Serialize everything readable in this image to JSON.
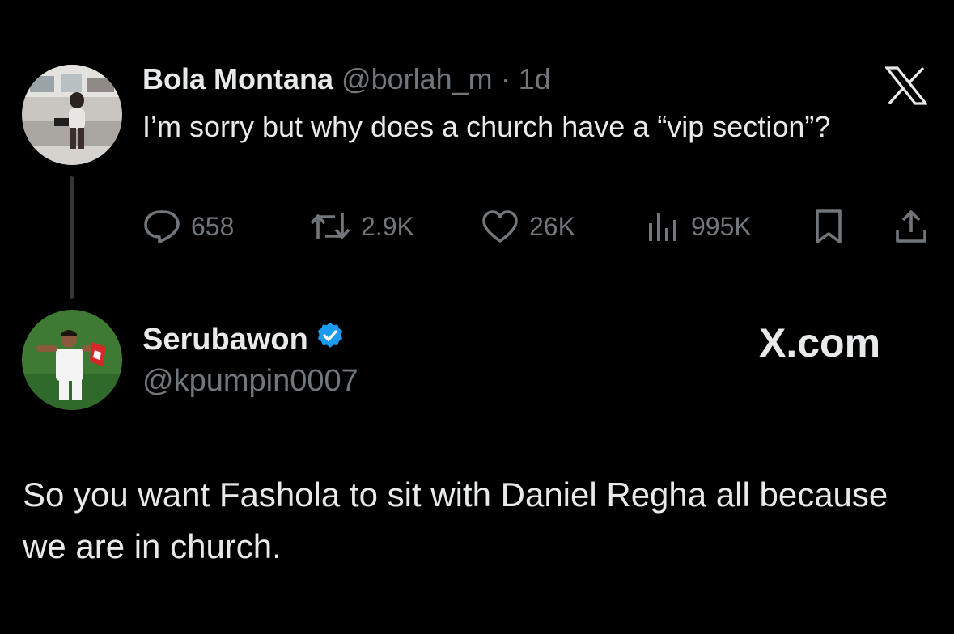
{
  "parent_tweet": {
    "author_name": "Bola Montana",
    "author_handle": "@borlah_m",
    "separator": "·",
    "time": "1d",
    "text": "I’m sorry but why does a church have a “vip section”?",
    "actions": {
      "replies": "658",
      "reposts": "2.9K",
      "likes": "26K",
      "views": "995K"
    },
    "icons": [
      "reply-icon",
      "repost-icon",
      "like-icon",
      "views-icon",
      "bookmark-icon",
      "share-icon",
      "x-logo-icon"
    ]
  },
  "reply_tweet": {
    "author_name": "Serubawon",
    "author_handle": "@kpumpin0007",
    "verified": true,
    "text": "So you want Fashola to sit with Daniel Regha all because we are in church.",
    "watermark": "X.com"
  },
  "colors": {
    "background": "#000000",
    "text_primary": "#e7e9ea",
    "text_secondary": "#71767b",
    "verified_badge": "#1d9bf0",
    "thread_line": "#333639"
  }
}
